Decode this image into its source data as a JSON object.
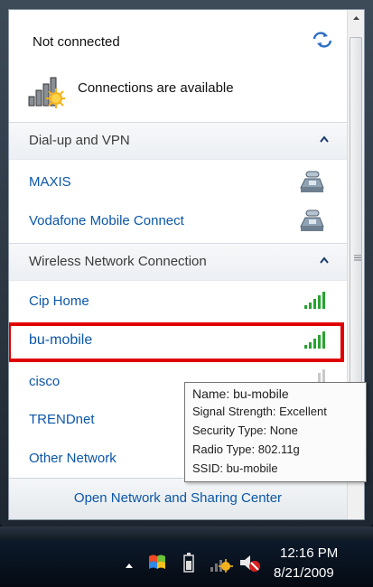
{
  "header": {
    "status": "Not connected",
    "availability": "Connections are available"
  },
  "sections": {
    "dialup": {
      "label": "Dial-up and VPN",
      "items": [
        "MAXIS",
        "Vodafone Mobile Connect"
      ]
    },
    "wireless": {
      "label": "Wireless Network Connection",
      "items": [
        "Cip Home",
        "bu-mobile",
        "cisco",
        "TRENDnet",
        "Other Network"
      ]
    }
  },
  "footer": {
    "link": "Open Network and Sharing Center"
  },
  "tooltip": {
    "name": "Name: bu-mobile",
    "signal": "Signal Strength: Excellent",
    "security": "Security Type: None",
    "radio": "Radio Type: 802.11g",
    "ssid": "SSID: bu-mobile"
  },
  "clock": {
    "time": "12:16 PM",
    "date": "8/21/2009"
  },
  "colors": {
    "link": "#0b57a8",
    "highlight": "#e00000",
    "signal": "#2aa332"
  },
  "icons": [
    "refresh-icon",
    "network-status-icon",
    "collapse-caret-icon",
    "dialup-phone-icon",
    "signal-bars-icon",
    "scroll-up-icon",
    "tray-chevron-icon",
    "tray-flag-icon",
    "tray-battery-icon",
    "tray-network-icon",
    "tray-volume-muted-icon"
  ]
}
